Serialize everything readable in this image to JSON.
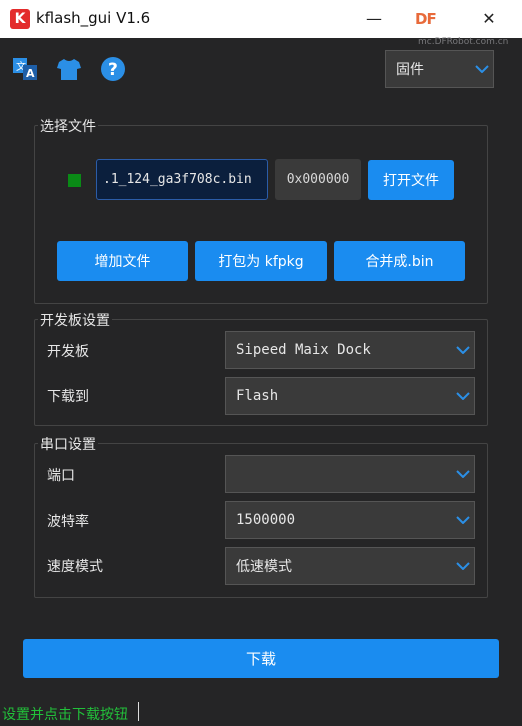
{
  "window": {
    "logo_letter": "K",
    "title": "kflash_gui V1.6",
    "minimize_glyph": "—",
    "close_glyph": "✕",
    "watermark": "DF",
    "watermark_sub": "mc.DFRobot.com.cn"
  },
  "toolbar": {
    "icons": [
      "translate-icon",
      "tshirt-icon",
      "help-icon"
    ],
    "firmware_select": {
      "value": "固件"
    }
  },
  "file_section": {
    "title": "选择文件",
    "file_name": ".1_124_ga3f708c.bin",
    "address": "0x000000",
    "open_button": "打开文件",
    "add_button": "增加文件",
    "pack_button": "打包为 kfpkg",
    "merge_button": "合并成.bin",
    "status_color": "#0a8a16"
  },
  "board_section": {
    "title": "开发板设置",
    "board_label": "开发板",
    "board_value": "Sipeed Maix Dock",
    "download_to_label": "下载到",
    "download_to_value": "Flash"
  },
  "serial_section": {
    "title": "串口设置",
    "port_label": "端口",
    "port_value": "",
    "baud_label": "波特率",
    "baud_value": "1500000",
    "speed_label": "速度模式",
    "speed_value": "低速模式"
  },
  "download_button": "下载",
  "status_text": "设置并点击下载按钮",
  "colors": {
    "accent": "#1a8cf0",
    "background": "#252526",
    "status_text": "#22c03a"
  }
}
